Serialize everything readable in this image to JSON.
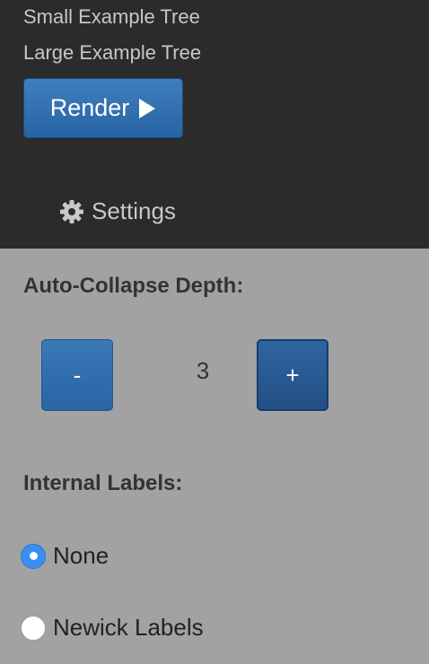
{
  "trees": {
    "small_label": "Small Example Tree",
    "large_label": "Large Example Tree"
  },
  "render": {
    "label": "Render",
    "icon": "play-icon"
  },
  "settings": {
    "label": "Settings",
    "icon": "gear-icon"
  },
  "auto_collapse": {
    "heading": "Auto-Collapse Depth:",
    "decrement_label": "-",
    "increment_label": "+",
    "value": "3"
  },
  "internal_labels": {
    "heading": "Internal Labels:",
    "options": [
      {
        "label": "None",
        "checked": true
      },
      {
        "label": "Newick Labels",
        "checked": false
      }
    ]
  },
  "colors": {
    "top_panel": "#2b2b2b",
    "body_background": "#a2a2a2",
    "button_blue": "#2f6eae",
    "radio_checked": "#3b8ff0"
  }
}
